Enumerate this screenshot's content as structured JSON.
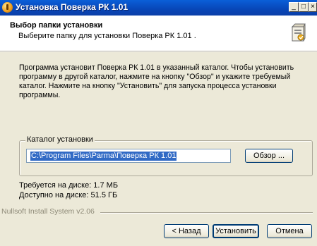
{
  "window": {
    "title": "Установка Поверка РК 1.01",
    "minimize_glyph": "_",
    "maximize_glyph": "□",
    "close_glyph": "×"
  },
  "header": {
    "title": "Выбор папки установки",
    "subtitle": "Выберите папку для установки Поверка РК 1.01 .",
    "icon": "installer-box-icon"
  },
  "description": "Программа установит Поверка РК 1.01  в указанный каталог. Чтобы установить программу в другой каталог, нажмите на кнопку \"Обзор\" и укажите требуемый каталог. Нажмите на кнопку \"Установить\" для запуска процесса установки программы.",
  "install_dir": {
    "legend": "Каталог установки",
    "path": "C:\\Program Files\\Parma\\Поверка РК 1.01",
    "browse_label": "Обзор ..."
  },
  "space": {
    "required": "Требуется на диске: 1.7 МБ",
    "available": "Доступно на диске: 51.5 ГБ"
  },
  "footer": {
    "branding": "Nullsoft Install System v2.06",
    "back_label": "< Назад",
    "install_label": "Установить",
    "cancel_label": "Отмена"
  }
}
